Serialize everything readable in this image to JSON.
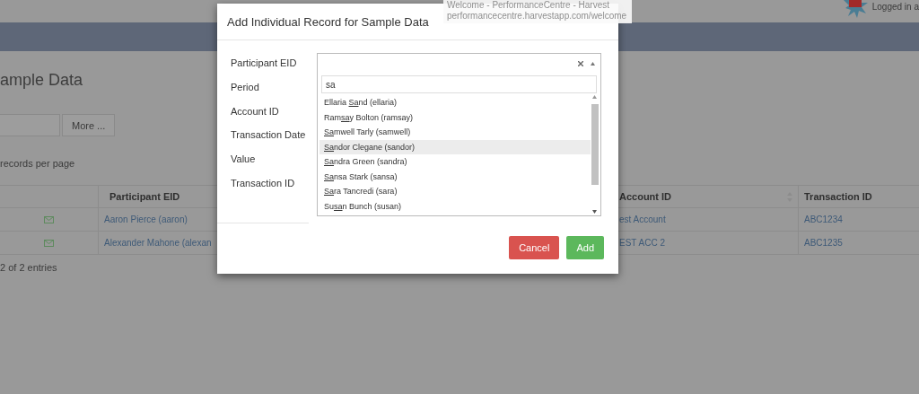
{
  "header": {
    "user_text": "Logged in a"
  },
  "tooltip": {
    "title": "Welcome - PerformanceCentre - Harvest",
    "url": "performancecentre.harvestapp.com/welcome"
  },
  "page": {
    "title": "ample Data",
    "more_button": "More ...",
    "page_size_label": "records per page",
    "table": {
      "columns": [
        {
          "label": "Participant EID",
          "sortable": false
        },
        {
          "label": "Account ID",
          "sortable": true
        },
        {
          "label": "Transaction ID",
          "sortable": false
        }
      ],
      "rows": [
        {
          "participant": "Aaron Pierce (aaron)",
          "account": "est Account",
          "transaction": "ABC1234"
        },
        {
          "participant": "Alexander Mahone (alexan",
          "account": "EST ACC 2",
          "transaction": "ABC1235"
        }
      ]
    },
    "entries_text": "2 of 2 entries"
  },
  "modal": {
    "title": "Add Individual Record for Sample Data",
    "labels": [
      "Participant EID",
      "Period",
      "Account ID",
      "Transaction Date",
      "Value",
      "Transaction ID"
    ],
    "participant_select": {
      "search_value": "sa",
      "options": [
        {
          "before": "Ellaria ",
          "match": "Sa",
          "after": "nd (ellaria)",
          "selected": false
        },
        {
          "before": "Ram",
          "match": "sa",
          "after": "y Bolton (ramsay)",
          "selected": false
        },
        {
          "match": "Sa",
          "after": "mwell Tarly (samwell)",
          "selected": false
        },
        {
          "match": "Sa",
          "after": "ndor Clegane (sandor)",
          "selected": true
        },
        {
          "match": "Sa",
          "after": "ndra Green (sandra)",
          "selected": false
        },
        {
          "match": "Sa",
          "after": "nsa Stark (sansa)",
          "selected": false
        },
        {
          "match": "Sa",
          "after": "ra Tancredi (sara)",
          "selected": false
        },
        {
          "before": "Su",
          "match": "sa",
          "after": "n Bunch (susan)",
          "selected": false
        }
      ]
    },
    "buttons": [
      {
        "label": "Cancel",
        "kind": "danger"
      },
      {
        "label": "Add",
        "kind": "success"
      }
    ]
  }
}
